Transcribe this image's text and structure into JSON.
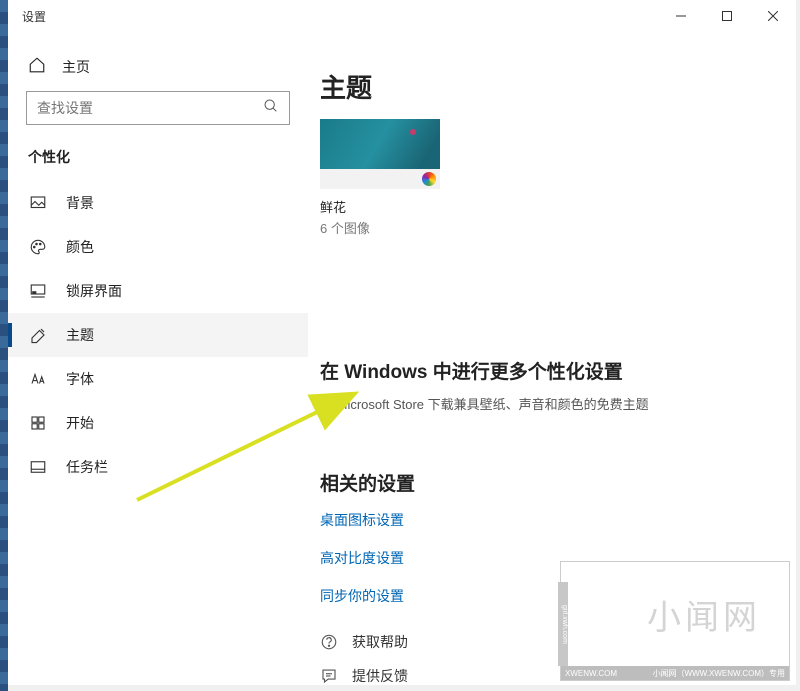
{
  "window": {
    "title": "设置"
  },
  "sidebar": {
    "home": "主页",
    "search_placeholder": "查找设置",
    "category": "个性化",
    "items": [
      {
        "label": "背景"
      },
      {
        "label": "颜色"
      },
      {
        "label": "锁屏界面"
      },
      {
        "label": "主题"
      },
      {
        "label": "字体"
      },
      {
        "label": "开始"
      },
      {
        "label": "任务栏"
      }
    ]
  },
  "main": {
    "title": "主题",
    "theme": {
      "name": "鲜花",
      "count": "6 个图像"
    },
    "more": {
      "title": "在 Windows 中进行更多个性化设置",
      "sub": "从 Microsoft Store 下载兼具壁纸、声音和颜色的免费主题"
    },
    "related": {
      "title": "相关的设置",
      "links": [
        {
          "label": "桌面图标设置"
        },
        {
          "label": "高对比度设置"
        },
        {
          "label": "同步你的设置"
        }
      ]
    },
    "help": {
      "label": "获取帮助"
    },
    "feedback": {
      "label": "提供反馈"
    }
  },
  "watermark": {
    "big": "小闻网",
    "bar_left": "XWENW.COM",
    "bar_right": "小闻网（WWW.XWENW.COM）专用"
  }
}
